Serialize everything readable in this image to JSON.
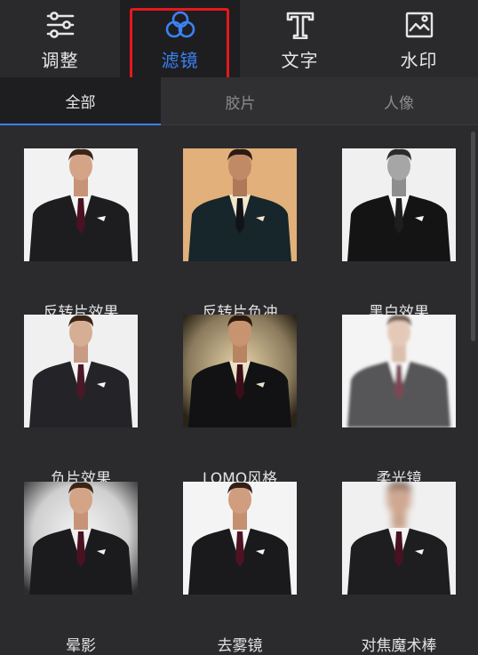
{
  "toolbar": {
    "items": [
      {
        "label": "调整",
        "icon": "sliders-icon"
      },
      {
        "label": "滤镜",
        "icon": "filter-circles-icon"
      },
      {
        "label": "文字",
        "icon": "text-t-icon"
      },
      {
        "label": "水印",
        "icon": "watermark-image-icon"
      }
    ],
    "accent": "#3b82f6",
    "highlight_color": "#e5181c"
  },
  "tabs": [
    {
      "label": "全部"
    },
    {
      "label": "胶片"
    },
    {
      "label": "人像"
    }
  ],
  "filters": [
    {
      "name": "反转片效果"
    },
    {
      "name": "反转片负冲"
    },
    {
      "name": "黑白效果"
    },
    {
      "name": "负片效果"
    },
    {
      "name": "LOMO风格"
    },
    {
      "name": "柔光镜"
    },
    {
      "name": "晕影"
    },
    {
      "name": "去雾镜"
    },
    {
      "name": "对焦魔术棒"
    }
  ]
}
